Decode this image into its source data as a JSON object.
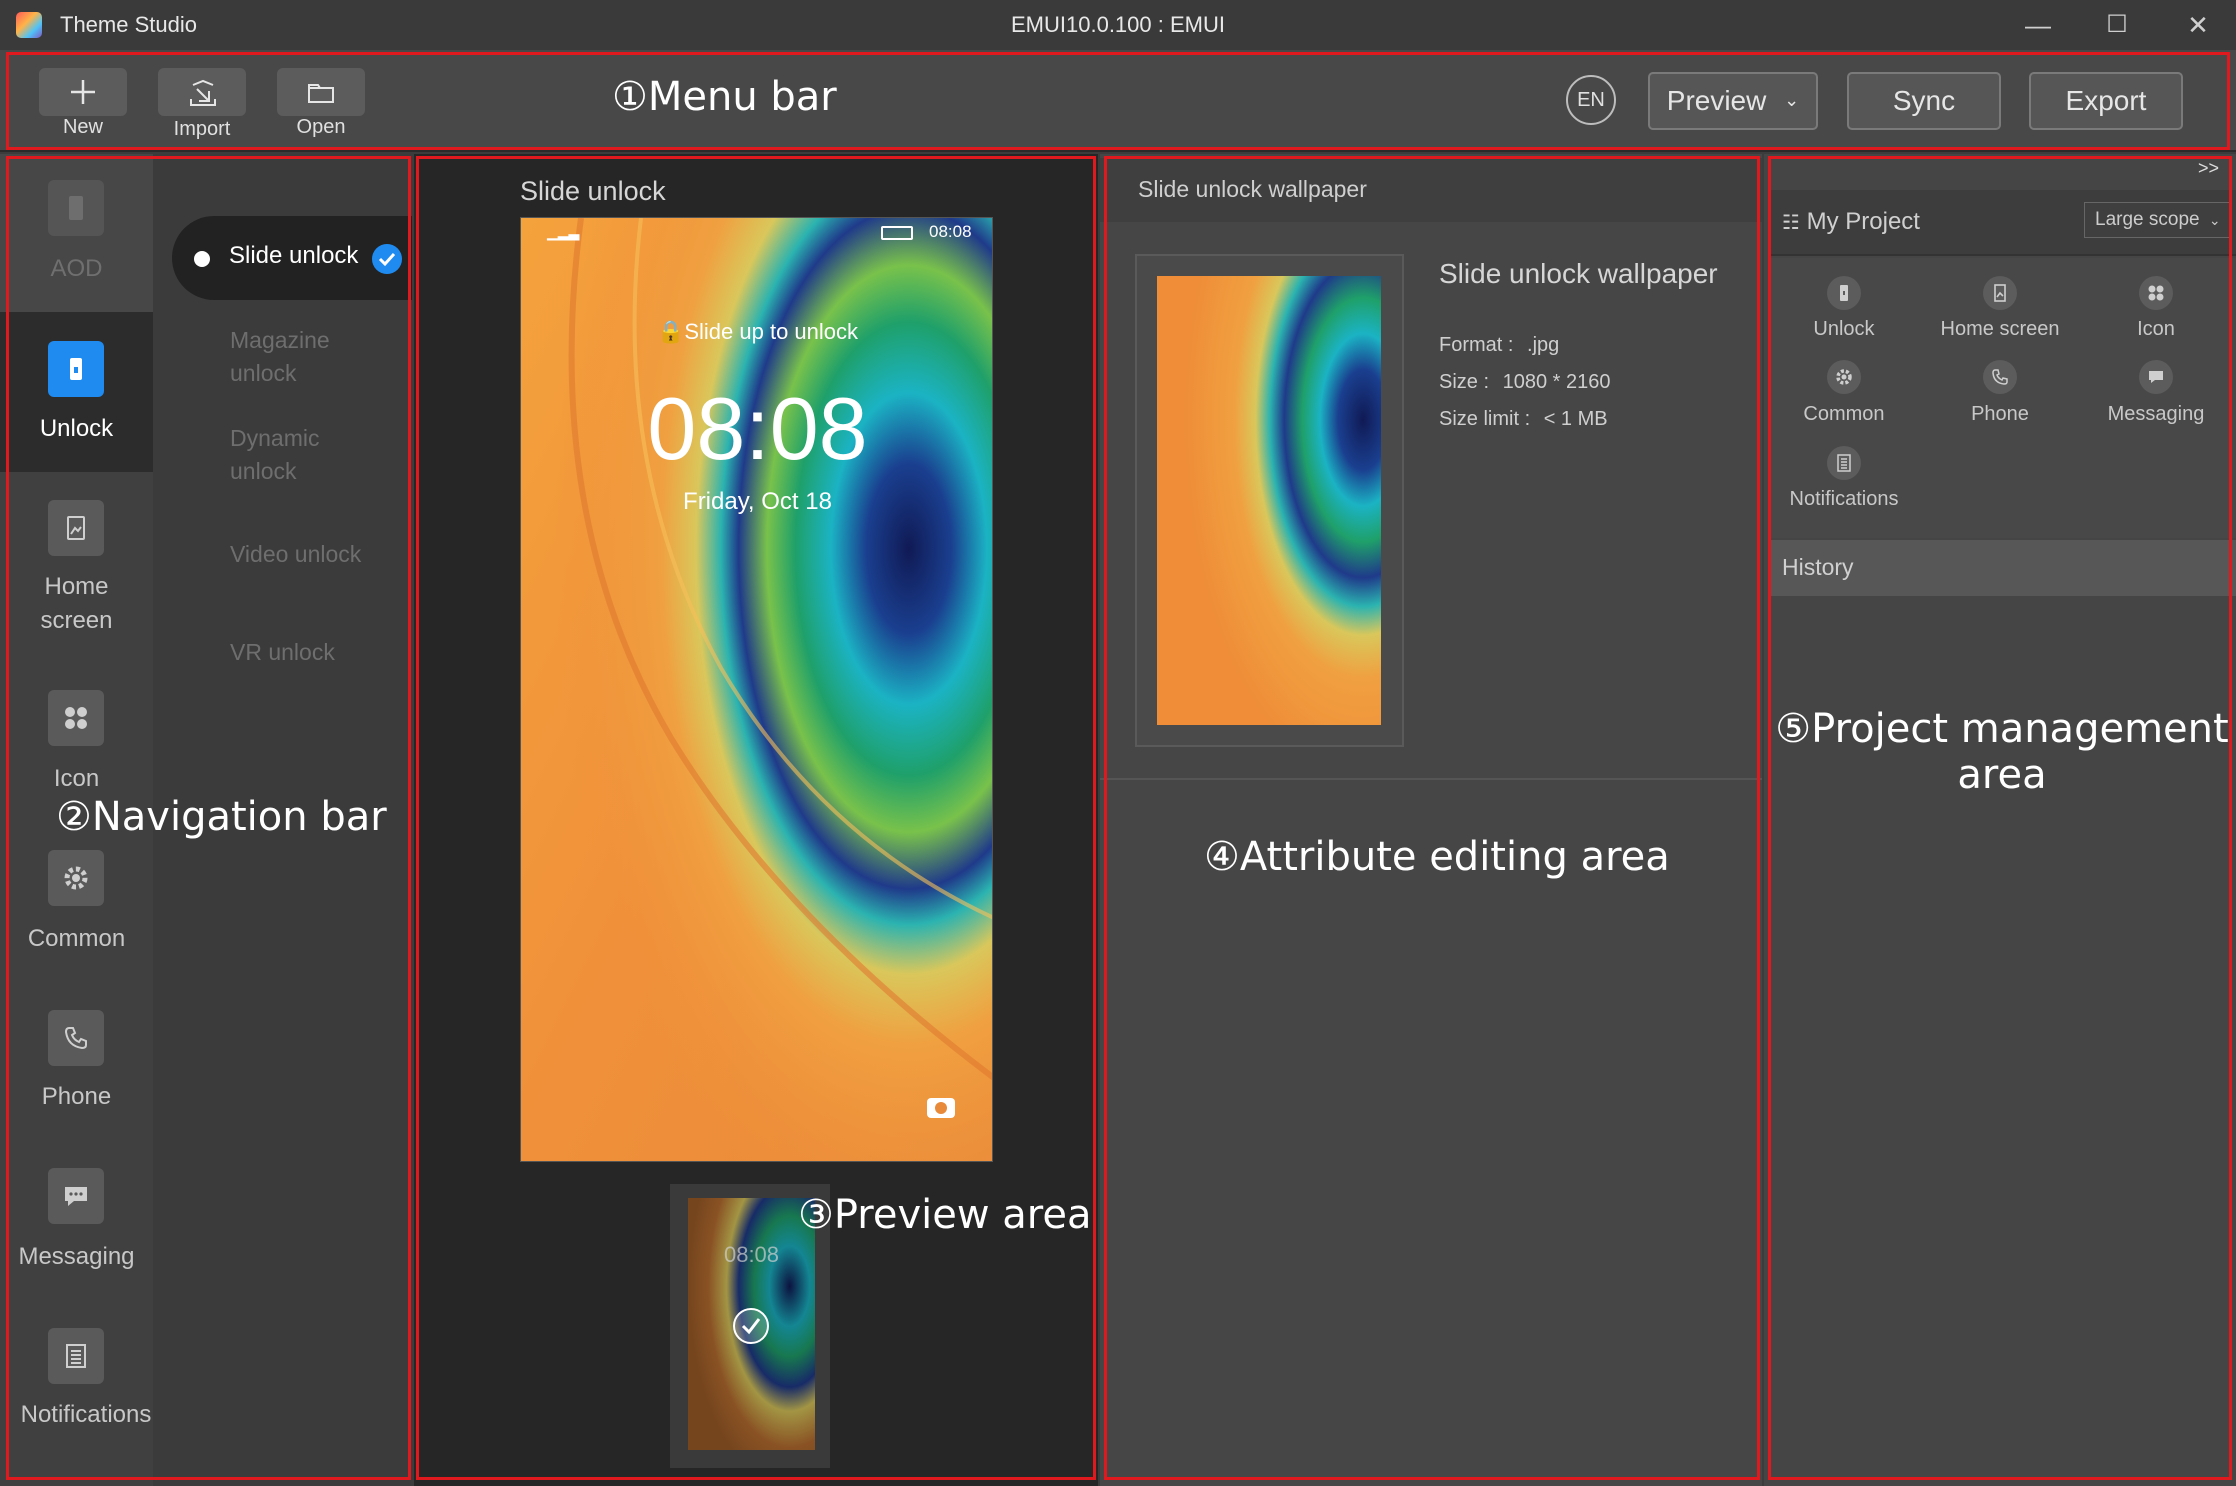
{
  "titlebar": {
    "app_title": "Theme Studio",
    "window_title": "EMUI10.0.100 : EMUI",
    "minimize": "—",
    "maximize": "☐",
    "close": "✕"
  },
  "menubar": {
    "new_label": "New",
    "import_label": "Import",
    "open_label": "Open",
    "lang": "EN",
    "preview_label": "Preview",
    "sync_label": "Sync",
    "export_label": "Export"
  },
  "annotations": {
    "menu_bar": "①Menu bar",
    "navigation_bar": "②Navigation bar",
    "preview_area": "③Preview area",
    "attribute_area": "④Attribute editing area",
    "project_area_1": "⑤Project management",
    "project_area_2": "area"
  },
  "nav": {
    "items": [
      {
        "label": "AOD",
        "icon": "phone-icon"
      },
      {
        "label": "Unlock",
        "icon": "unlock-icon"
      },
      {
        "label_1": "Home",
        "label_2": "screen",
        "icon": "home-screen-icon"
      },
      {
        "label": "Icon",
        "icon": "grid-icon"
      },
      {
        "label": "Common",
        "icon": "gear-icon"
      },
      {
        "label": "Phone",
        "icon": "phone-call-icon"
      },
      {
        "label": "Messaging",
        "icon": "message-icon"
      },
      {
        "label": "Notifications",
        "icon": "notification-icon"
      }
    ],
    "sub_items": [
      {
        "label": "Slide unlock"
      },
      {
        "label_1": "Magazine",
        "label_2": "unlock"
      },
      {
        "label_1": "Dynamic",
        "label_2": "unlock"
      },
      {
        "label": "Video unlock"
      },
      {
        "label": "VR unlock"
      }
    ]
  },
  "preview": {
    "title": "Slide unlock",
    "status_time": "08:08",
    "slide_text": "Slide up to unlock",
    "clock": "08:08",
    "date": "Friday, Oct 18",
    "thumb_clock": "08:08"
  },
  "attribute": {
    "header": "Slide unlock wallpaper",
    "title": "Slide unlock wallpaper",
    "format_label": "Format :",
    "format_value": ".jpg",
    "size_label": "Size :",
    "size_value": "1080 * 2160",
    "limit_label": "Size limit :",
    "limit_value": "< 1 MB"
  },
  "project": {
    "collapse": ">>",
    "title": "My Project",
    "scope": "Large scope",
    "tiles": [
      {
        "label": "Unlock",
        "icon": "unlock-icon"
      },
      {
        "label": "Home screen",
        "icon": "home-screen-icon"
      },
      {
        "label": "Icon",
        "icon": "grid-icon"
      },
      {
        "label": "Common",
        "icon": "gear-icon"
      },
      {
        "label": "Phone",
        "icon": "phone-call-icon"
      },
      {
        "label": "Messaging",
        "icon": "message-icon"
      },
      {
        "label": "Notifications",
        "icon": "notification-icon"
      }
    ],
    "history": "History"
  },
  "colors": {
    "annotation_red": "#e0191f",
    "active_blue": "#1f8bf0"
  }
}
